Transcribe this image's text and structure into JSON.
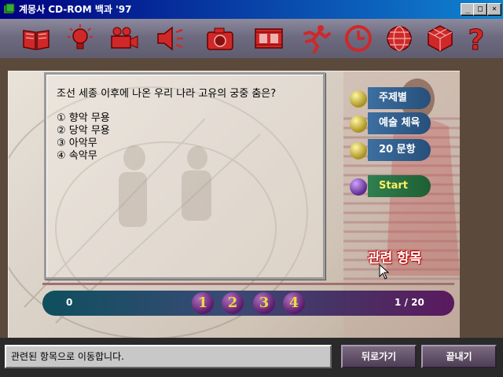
{
  "window": {
    "title": "계몽사 CD-ROM 백과 '97",
    "minimize": "_",
    "maximize": "□",
    "close": "×"
  },
  "toolbar": {
    "icons": [
      "book-icon",
      "lightbulb-icon",
      "movie-camera-icon",
      "speaker-icon",
      "camera-icon",
      "film-icon",
      "runner-icon",
      "clock-icon",
      "globe-icon",
      "puzzle-cube-icon",
      "question-mark-icon"
    ],
    "help_glyph": "?"
  },
  "quiz": {
    "question": "조선 세종 이후에 나온 우리 나라 고유의 궁중 춤은?",
    "options": [
      "① 향악 무용",
      "② 당악 무용",
      "③ 아악무",
      "④ 속악무"
    ]
  },
  "side_menu": {
    "topic": "주제별",
    "arts_sports": "예술 체육",
    "twenty_questions": "20 문항",
    "start": "Start",
    "related": "관련 항목"
  },
  "navbar": {
    "score": "0",
    "pages": [
      "1",
      "2",
      "3",
      "4"
    ],
    "progress": "1 / 20"
  },
  "status": {
    "message": "관련된 항목으로 이동합니다.",
    "back": "뒤로가기",
    "exit": "끝내기"
  },
  "colors": {
    "titlebar": "#000080",
    "menu_blue": "#2f5f8f",
    "menu_green": "#2f6f3f",
    "icon_red": "#cc2020"
  }
}
